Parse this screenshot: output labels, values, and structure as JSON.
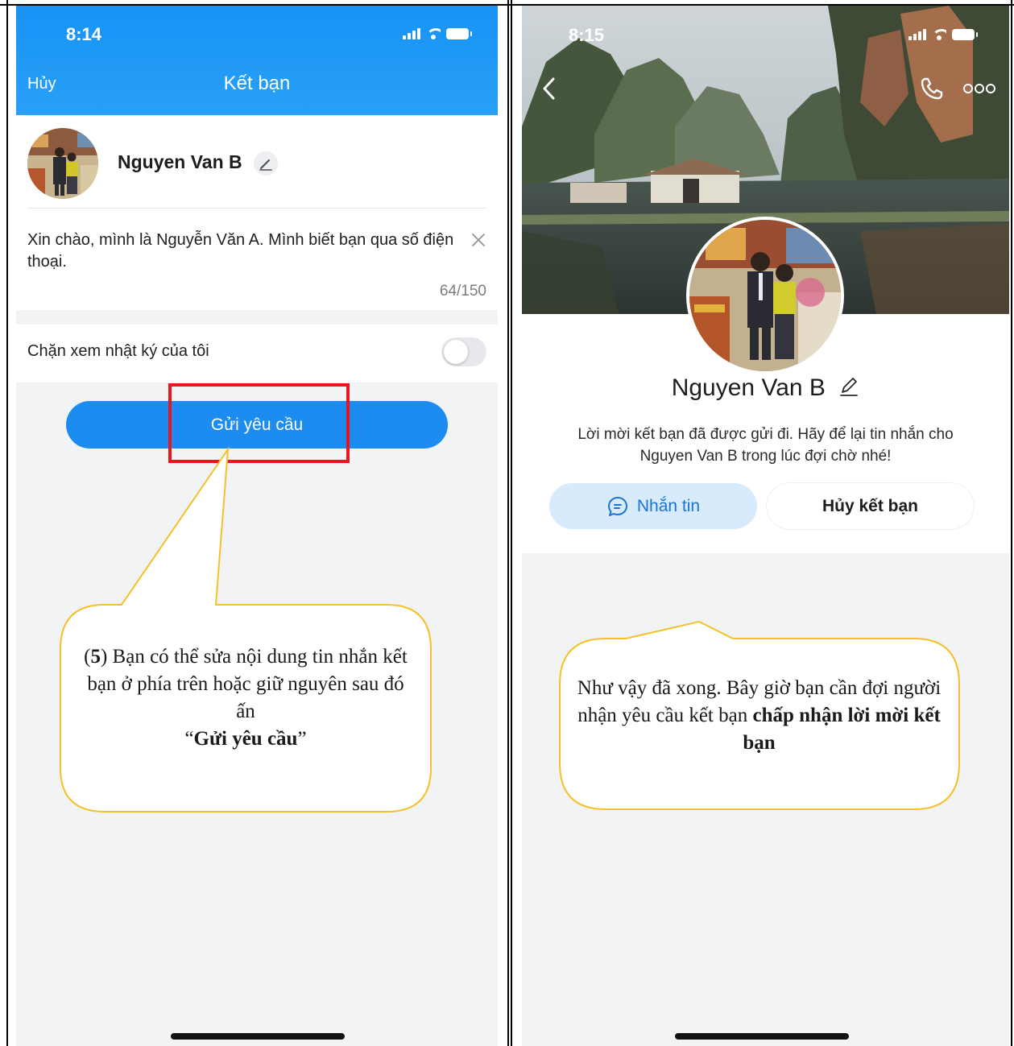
{
  "screenA": {
    "status": {
      "time": "8:14"
    },
    "header": {
      "cancel_label": "Hủy",
      "title": "Kết bạn"
    },
    "contact_name": "Nguyen Van B",
    "greeting_message": "Xin chào, mình là Nguyễn Văn A. Mình biết bạn qua số điện thoại.",
    "char_count": "64/150",
    "block_diary_label": "Chặn xem nhật ký của tôi",
    "block_diary_enabled": false,
    "send_button_label": "Gửi yêu cầu"
  },
  "screenB": {
    "status": {
      "time": "8:15"
    },
    "contact_name": "Nguyen Van B",
    "sent_description": "Lời mời kết bạn đã được gửi đi. Hãy để lại tin nhắn cho Nguyen Van B trong lúc đợi chờ nhé!",
    "message_button_label": "Nhắn tin",
    "unfriend_button_label": "Hủy kết bạn"
  },
  "callouts": {
    "step_number": "5",
    "callout1_line1_rest": ") Bạn có thể sửa nội dung tin nhắn kết bạn ở phía trên hoặc giữ nguyên sau đó ấn",
    "callout1_quoted": "Gửi yêu cầu",
    "callout2_plain": "Như vậy đã xong. Bây giờ bạn cần đợi người nhận yêu cầu kết bạn",
    "callout2_bold": "chấp nhận lời mời kết bạn"
  },
  "colors": {
    "header_blue": "#1693f5",
    "primary_button": "#1d8cf0",
    "highlight_red": "#e6161e",
    "callout_border": "#f5c12a",
    "message_button_bg": "#d8ebfc"
  },
  "icons": [
    "signal-icon",
    "wifi-icon",
    "battery-icon",
    "pencil-icon",
    "close-icon",
    "chevron-left-icon",
    "phone-icon",
    "more-dots-icon",
    "chat-bubble-icon"
  ]
}
